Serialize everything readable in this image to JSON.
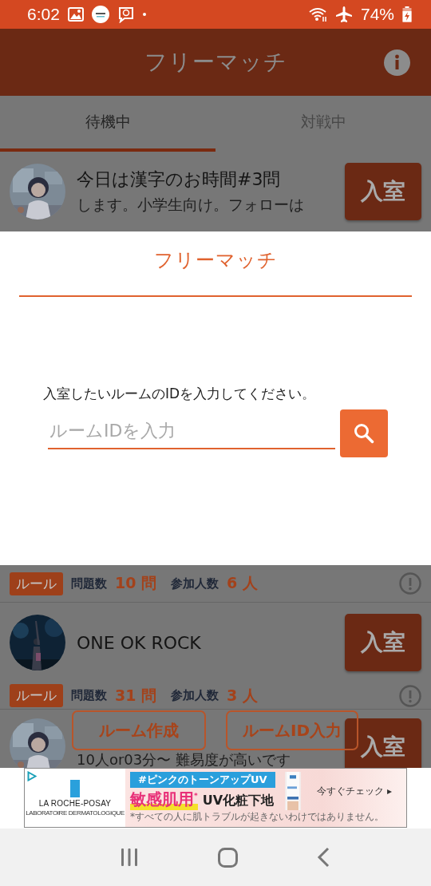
{
  "status_bar": {
    "time": "6:02",
    "battery": "74%"
  },
  "app_bar": {
    "title": "フリーマッチ"
  },
  "tabs": [
    {
      "label": "待機中",
      "selected": true
    },
    {
      "label": "対戦中",
      "selected": false
    }
  ],
  "list_top": [
    {
      "kind": "room",
      "title": "今日は漢字のお時間#3問",
      "subtitle": "します。小学生向け。フォローは",
      "button": "入室"
    }
  ],
  "dialog": {
    "title": "フリーマッチ",
    "instruction": "入室したいルームのIDを入力してください。",
    "input": {
      "placeholder": "ルームIDを入力"
    }
  },
  "list_bottom": [
    {
      "kind": "rules",
      "tag": "ルール",
      "questions_label": "問題数",
      "questions": "10 問",
      "players_label": "参加人数",
      "players": "6 人"
    },
    {
      "kind": "room",
      "title": "ONE OK ROCK",
      "button": "入室"
    },
    {
      "kind": "rules",
      "tag": "ルール",
      "questions_label": "問題数",
      "questions": "31 問",
      "players_label": "参加人数",
      "players": "3 人"
    },
    {
      "kind": "room",
      "subtitle": "10人or03分〜 難易度が高いです",
      "button": "入室"
    }
  ],
  "actions": [
    "ルーム作成",
    "ルームID入力"
  ],
  "ad": {
    "brand": "LA ROCHE-POSAY",
    "brand_sub": "LABORATOIRE DERMATOLOGIQUE",
    "tagline": "#ピンクのトーンアップUV",
    "headline": "敏感肌用$^{*}$",
    "product": "UV化粧下地",
    "disclaimer": "*すべての人に肌トラブルが起きないわけではありません。",
    "cta": "今すぐチェック ▸"
  }
}
